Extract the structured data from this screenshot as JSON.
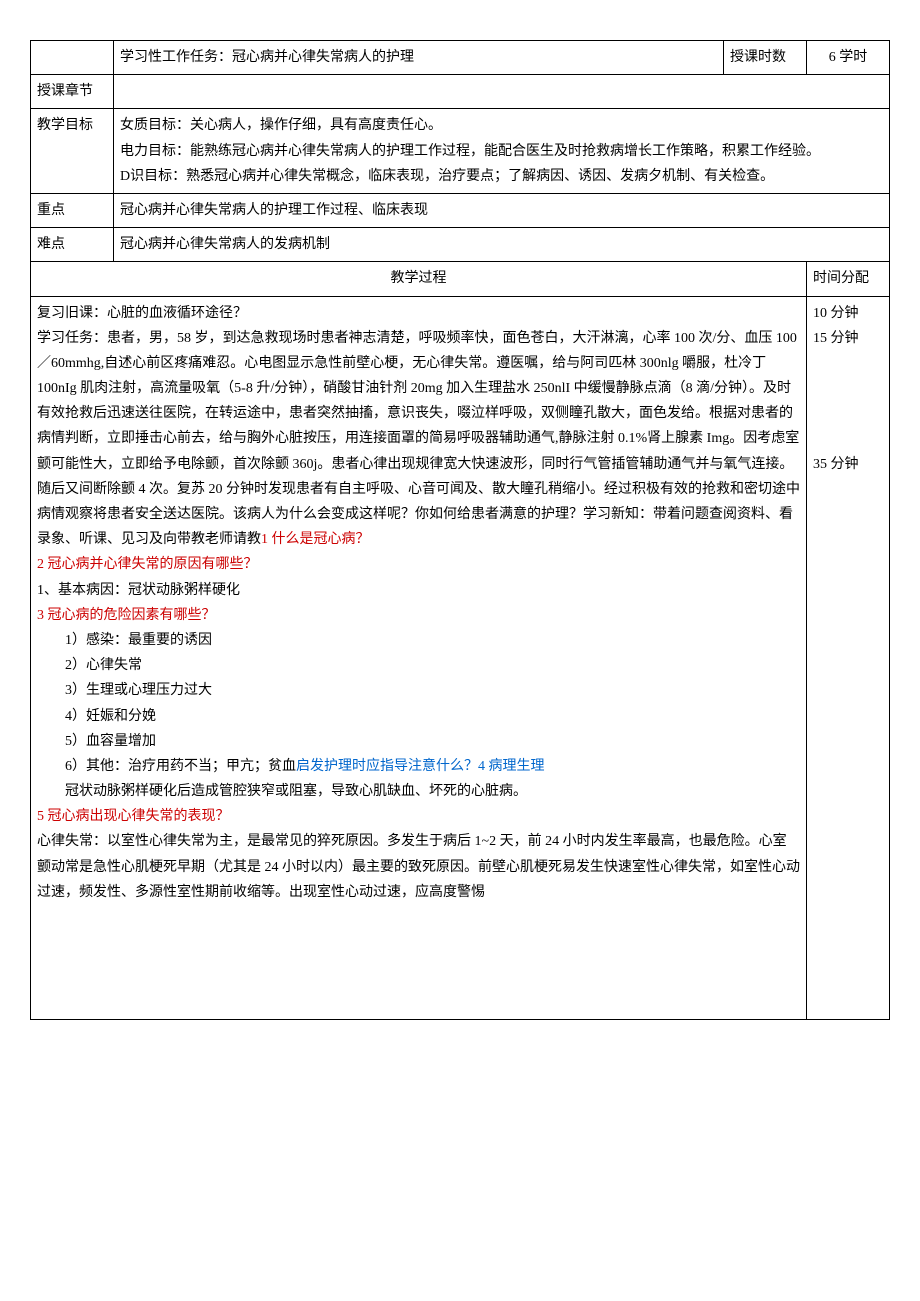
{
  "header": {
    "task_label_cell_empty": "",
    "task_text": "学习性工作任务：冠心病并心律失常病人的护理",
    "hours_label": "授课时数",
    "hours_value": "6 学时",
    "chapter_label": "授课章节",
    "chapter_value": ""
  },
  "goals": {
    "label": "教学目标",
    "line1": "女质目标：关心病人，操作仔细，具有高度责任心。",
    "line2": "电力目标：能熟练冠心病并心律失常病人的护理工作过程，能配合医生及时抢救病增长工作策略，积累工作经验。",
    "line3": "D识目标：熟悉冠心病并心律失常概念，临床表现，治疗要点；了解病因、诱因、发病夕机制、有关检查。"
  },
  "keypoint": {
    "label": "重点",
    "value": "冠心病并心律失常病人的护理工作过程、临床表现"
  },
  "difficulty": {
    "label": "难点",
    "value": "冠心病并心律失常病人的发病机制"
  },
  "process": {
    "title": "教学过程",
    "time_col_label": "时间分配"
  },
  "body": {
    "review_label": "复习旧课：",
    "review_text": "心脏的血液循环途径？",
    "task_label": "学习任务：",
    "task_para_1": "患者，男，58 岁，到达急救现场时患者神志清楚，呼吸频率快，面色苍白，大汗淋漓，心率 100 次/分、血压 100／60mmhg,自述心前区疼痛难忍。心电图显示急性前壁心梗，无心律失常。遵医嘱，给与阿司匹林 300nlg 嚼服，杜冷丁 100nIg 肌肉注射，高流量吸氧（5-8 升/分钟），硝酸甘油针剂 20mg 加入生理盐水 250nlI 中缓慢静脉点滴（8 滴/分钟）。及时有效抢救后迅速送往医院，在转运途中，患者突然抽搐，意识丧失，啜泣样呼吸，双侧瞳孔散大，面色发给。根据对患者的病情判断，立即捶击心前去，给与胸外心脏按压，用连接面罩的简易呼吸器辅助通气,静脉注射 0.1%肾上腺素 Img。因考虑室颤可能性大，立即给予电除颤，首次除颤 360j。患者心律出现规律宽大快速波形，同时行气管插管辅助通气并与氧气连接。随后又间断除颤 4 次。复苏 20 分钟时发现患者有自主呼吸、心音可闻及、散大瞳孔稍缩小。经过积极有效的抢救和密切途中病情观察将患者安全送达医院。该病人为什么会变成这样呢？你如何给患者满意的护理？",
    "new_label": "学习新知：",
    "new_text": "带着问题查阅资料、看录象、听课、见习及向带教老师请教",
    "q1": "1 什么是冠心病？",
    "q2": "2 冠心病并心律失常的原因有哪些？",
    "a2_label": "1、基本病因：",
    "a2_text": "冠状动脉粥样硬化",
    "q3": "3 冠心病的危险因素有哪些？",
    "f1": "1）感染：最重要的诱因",
    "f2": "2）心律失常",
    "f3": "3）生理或心理压力过大",
    "f4": "4）妊娠和分娩",
    "f5": "5）血容量增加",
    "f6_prefix": "6）其他：治疗用药不当；甲亢；贫血",
    "f6_blue": "启发护理时应指导注意什么？4 病理生理",
    "f6_line2": "冠状动脉粥样硬化后造成管腔狭窄或阻塞，导致心肌缺血、坏死的心脏病。",
    "q5": "5 冠心病出现心律失常的表现？",
    "a5": "心律失常：以室性心律失常为主，是最常见的猝死原因。多发生于病后 1~2 天，前 24 小时内发生率最高，也最危险。心室颤动常是急性心肌梗死早期（尤其是 24 小时以内）最主要的致死原因。前壁心肌梗死易发生快速室性心律失常，如室性心动过速，频发性、多源性室性期前收缩等。出现室性心动过速，应高度警惕"
  },
  "times": {
    "t1": "10 分钟",
    "t2": "15 分钟",
    "t3": "35 分钟"
  }
}
